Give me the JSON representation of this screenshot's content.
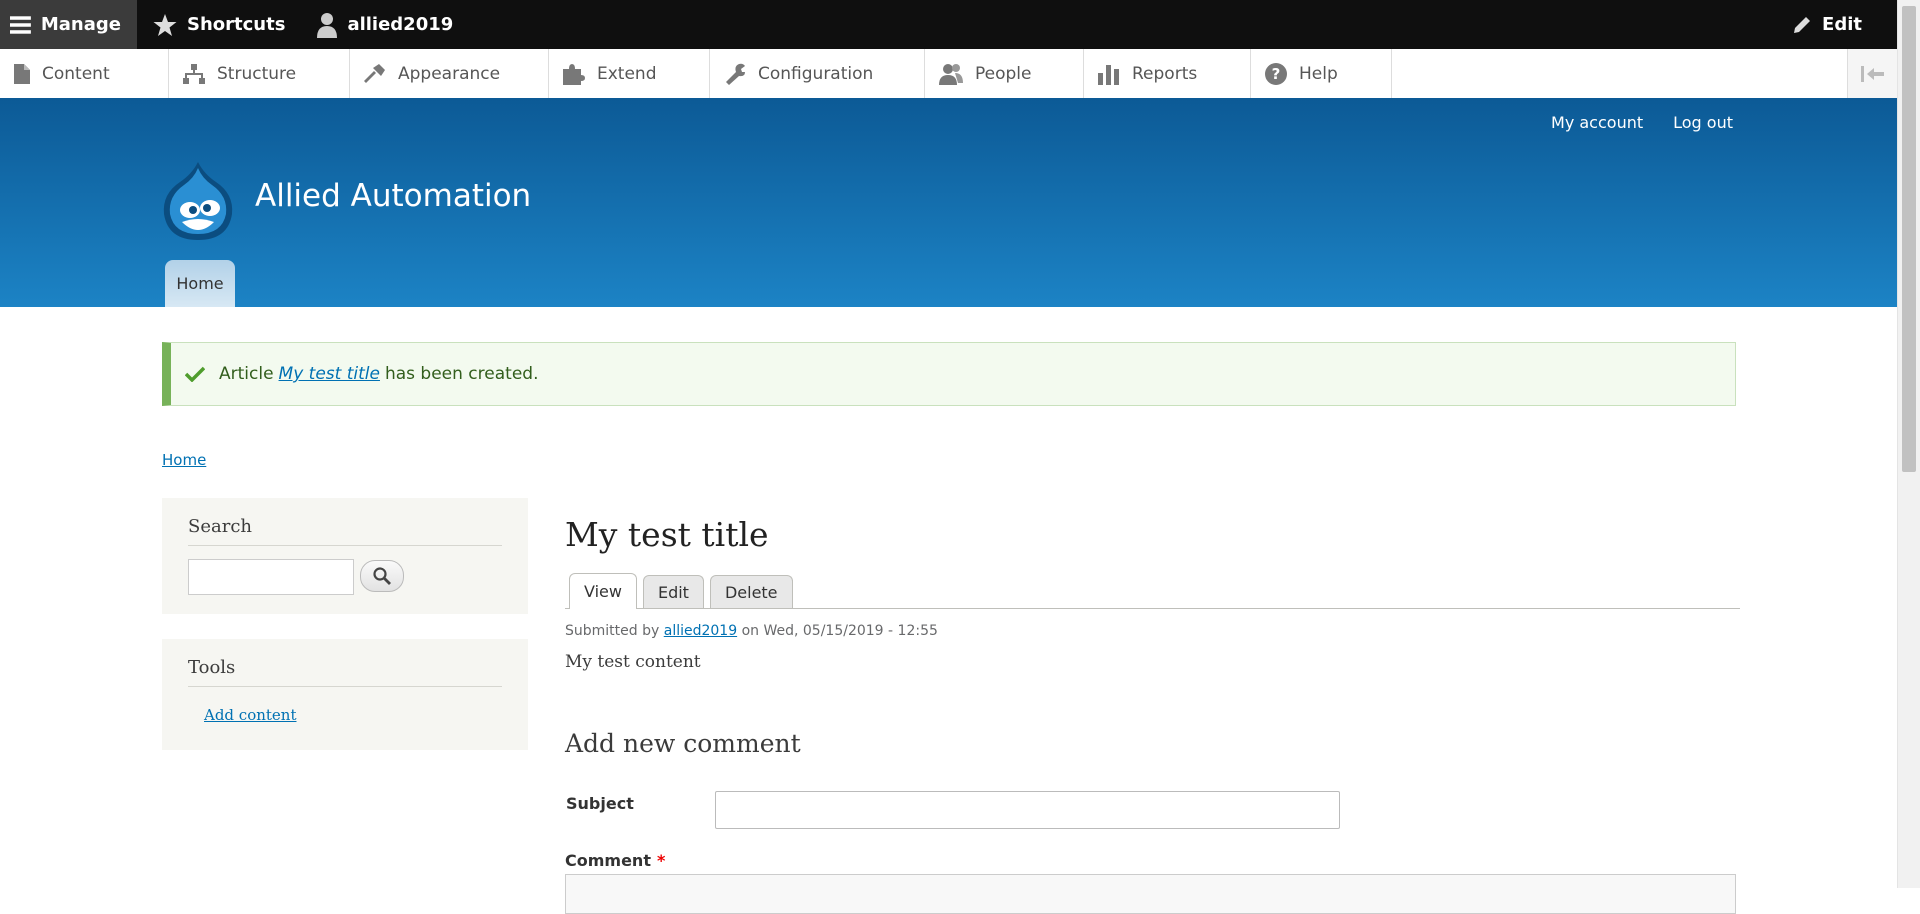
{
  "toolbar": {
    "manage": "Manage",
    "shortcuts": "Shortcuts",
    "user": "allied2019",
    "edit": "Edit"
  },
  "tray": {
    "items": [
      "Content",
      "Structure",
      "Appearance",
      "Extend",
      "Configuration",
      "People",
      "Reports",
      "Help"
    ]
  },
  "header": {
    "my_account": "My account",
    "log_out": "Log out",
    "site_name": "Allied Automation",
    "home_tab": "Home"
  },
  "message": {
    "prefix": "Article",
    "link": "My test title",
    "suffix": "has been created."
  },
  "breadcrumb": "Home",
  "sidebar": {
    "search_title": "Search",
    "tools_title": "Tools",
    "add_content": "Add content"
  },
  "node": {
    "title": "My test title",
    "tabs": [
      "View",
      "Edit",
      "Delete"
    ],
    "submitted_by": "Submitted by",
    "author": "allied2019",
    "date": "on Wed, 05/15/2019 - 12:55",
    "body": "My test content"
  },
  "comment": {
    "heading": "Add new comment",
    "subject_label": "Subject",
    "comment_label": "Comment",
    "required_mark": "*"
  },
  "colors": {
    "header_top": "#0c5a96",
    "header_bottom": "#1c83c5",
    "link": "#0071b3",
    "status_green": "#77b259"
  }
}
